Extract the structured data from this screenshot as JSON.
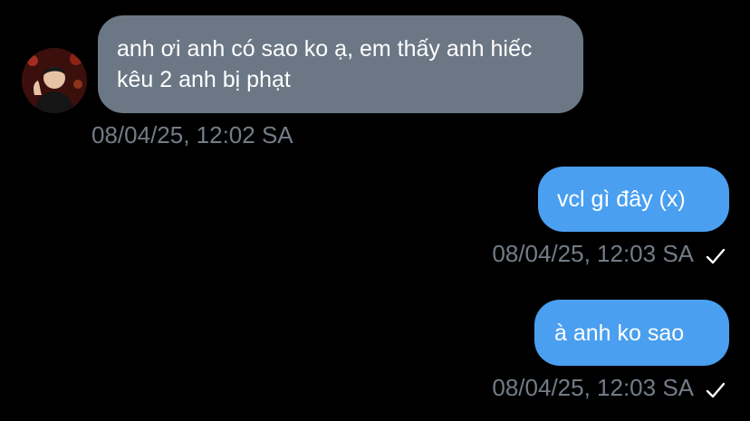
{
  "messages": [
    {
      "direction": "incoming",
      "text": "anh ơi anh có sao ko ạ, em thấy anh hiếc kêu 2 anh bị phạt",
      "timestamp": "08/04/25, 12:02 SA",
      "avatar": "user-avatar-icon"
    },
    {
      "direction": "outgoing",
      "text": "vcl gì đây (x)",
      "timestamp": "08/04/25, 12:03 SA",
      "status_icon": "checkmark-icon"
    },
    {
      "direction": "outgoing",
      "text": "à anh ko sao",
      "timestamp": "08/04/25, 12:03 SA",
      "status_icon": "checkmark-icon"
    }
  ],
  "colors": {
    "background": "#000000",
    "incoming_bubble": "#6b7785",
    "outgoing_bubble": "#4a9ff0",
    "timestamp": "#737c87",
    "text": "#ffffff"
  }
}
